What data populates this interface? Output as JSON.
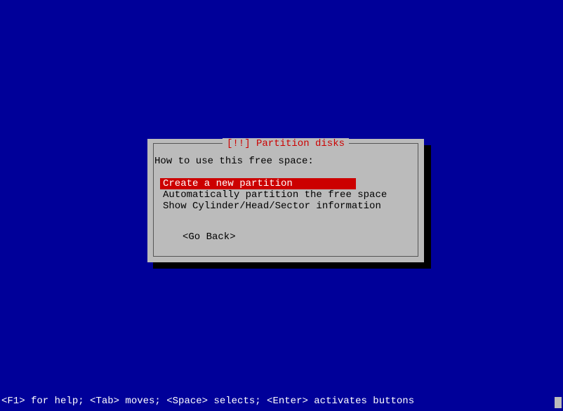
{
  "dialog": {
    "title": "[!!] Partition disks",
    "prompt": "How to use this free space:",
    "menu_items": [
      "Create a new partition",
      "Automatically partition the free space",
      "Show Cylinder/Head/Sector information"
    ],
    "selected_index": 0,
    "go_back_label": "<Go Back>"
  },
  "status_bar": "<F1> for help; <Tab> moves; <Space> selects; <Enter> activates buttons"
}
